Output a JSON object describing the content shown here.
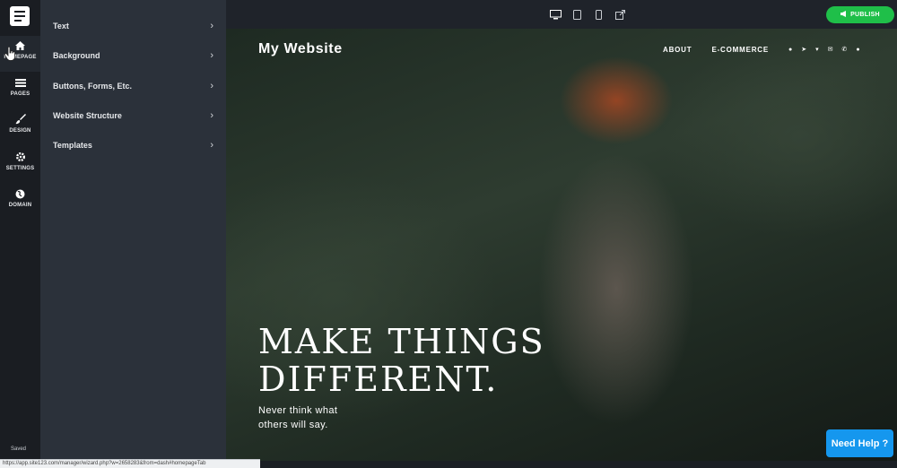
{
  "sidebar": {
    "items": [
      {
        "label": "HOMEPAGE",
        "icon": "home-icon"
      },
      {
        "label": "PAGES",
        "icon": "pages-icon"
      },
      {
        "label": "DESIGN",
        "icon": "brush-icon"
      },
      {
        "label": "SETTINGS",
        "icon": "gear-icon"
      },
      {
        "label": "DOMAIN",
        "icon": "globe-icon"
      }
    ],
    "saved_label": "Saved"
  },
  "panel": {
    "items": [
      {
        "label": "Text"
      },
      {
        "label": "Background"
      },
      {
        "label": "Buttons, Forms, Etc."
      },
      {
        "label": "Website Structure"
      },
      {
        "label": "Templates"
      }
    ]
  },
  "topbar": {
    "devices": [
      "desktop-icon",
      "tablet-icon",
      "mobile-icon",
      "external-link-icon"
    ],
    "publish_label": "PUBLISH"
  },
  "site": {
    "title": "My Website",
    "nav": [
      "ABOUT",
      "E-COMMERCE"
    ],
    "hero_line1": "MAKE THINGS",
    "hero_line2": "DIFFERENT.",
    "subtitle_line1": "Never think what",
    "subtitle_line2": "others will say."
  },
  "status_url": "https://app.site123.com/manager/wizard.php?w=2658283&from=dash#homepageTab",
  "help_label": "Need Help ?",
  "colors": {
    "publish": "#1fbf49",
    "help": "#1597ee",
    "panel": "#2b313a",
    "rail": "#1a1d22"
  }
}
